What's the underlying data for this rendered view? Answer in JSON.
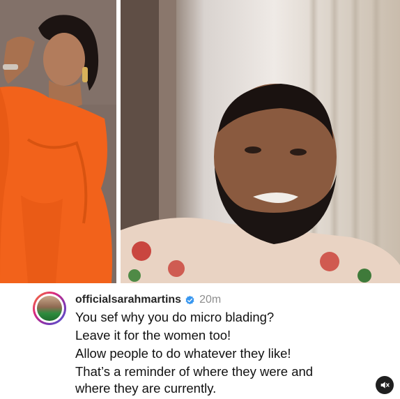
{
  "comment": {
    "username": "officialsarahmartins",
    "time": "20m",
    "lines": [
      "You sef why you do micro blading?",
      "Leave it for the women too!",
      "Allow people to do whatever they like!",
      "That’s a reminder of where they were and",
      "where they are currently."
    ]
  },
  "icons": {
    "verified": "verified-badge-icon",
    "mute": "speaker-muted-icon"
  },
  "colors": {
    "verified_blue": "#3897f0",
    "username": "#262626",
    "time": "#8e8e8e",
    "dress_orange": "#f2621b"
  }
}
